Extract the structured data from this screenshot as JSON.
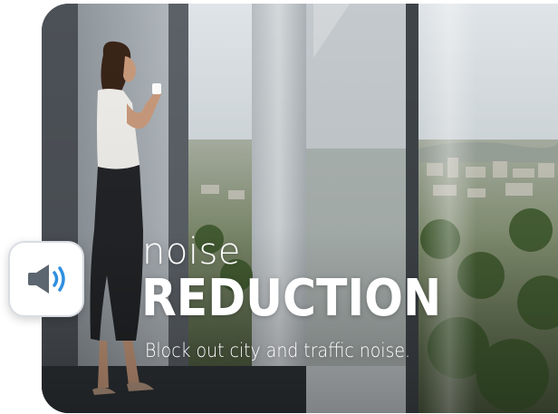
{
  "hero": {
    "image_icon": "office-window-woman-photo",
    "headline_sub": "noise",
    "headline_main": "REDUCTION",
    "tagline": "Block out city and traffic noise."
  },
  "sound_badge": {
    "icon": "speaker-sound-icon",
    "accent_color": "#2f8fe0"
  },
  "colors": {
    "text": "#ffffff",
    "badge_bg": "#ffffff",
    "badge_border": "#d9dde3"
  }
}
